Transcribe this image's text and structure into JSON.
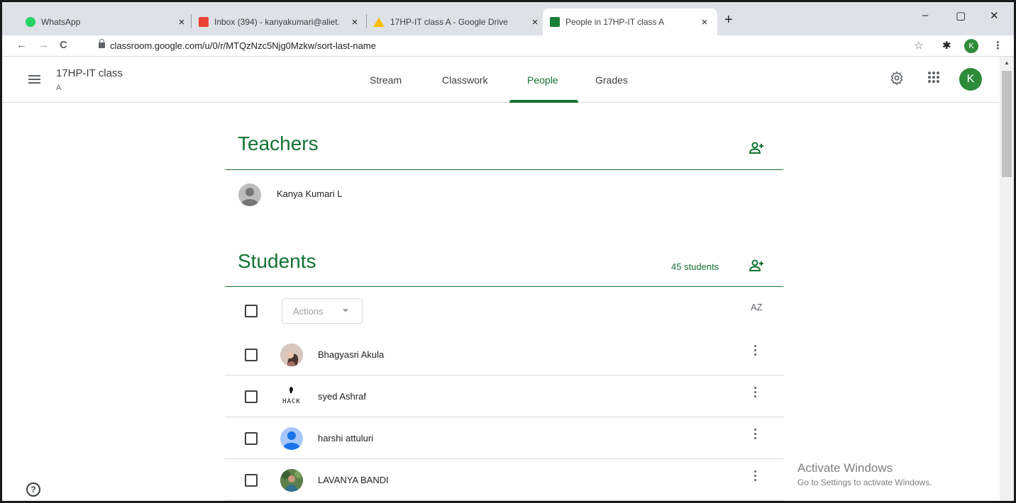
{
  "browser": {
    "tabs": [
      {
        "label": "WhatsApp",
        "favicon_color": "#25d366"
      },
      {
        "label": "Inbox (394) - kanyakumari@aliet.",
        "favicon_color": "#ea4335"
      },
      {
        "label": "17HP-IT class A - Google Drive",
        "favicon_color": "#fbbc04"
      },
      {
        "label": "People in 17HP-IT class A",
        "favicon_color": "#188038"
      }
    ],
    "tab_close": "×",
    "new_tab": "+",
    "window_controls": {
      "minimize": "–",
      "restore": "▢",
      "close": "✕"
    },
    "nav": {
      "back": "←",
      "forward": "→",
      "reload": "C"
    },
    "url": "classroom.google.com/u/0/r/MTQzNzc5Njg0Mzkw/sort-last-name",
    "profile_initial": "K",
    "icons": [
      "star-icon",
      "extensions-icon",
      "menu-dots-icon"
    ]
  },
  "classroom": {
    "class_name": "17HP-IT class",
    "class_section": "A",
    "tabs": [
      "Stream",
      "Classwork",
      "People",
      "Grades"
    ],
    "active_tab": "People",
    "account_initial": "K",
    "accent_color": "#137333"
  },
  "teachers": {
    "title": "Teachers",
    "list": [
      {
        "name": "Kanya Kumari L"
      }
    ]
  },
  "students": {
    "title": "Students",
    "count_label": "45 students",
    "actions_label": "Actions",
    "sort_label": "AZ",
    "list": [
      {
        "name": "Bhagyasri Akula",
        "avatar": "photo-avatar"
      },
      {
        "name": "syed Ashraf",
        "avatar": "hack-logo-avatar",
        "avatar_text": "HACK"
      },
      {
        "name": "harshi attuluri",
        "avatar": "default-avatar"
      },
      {
        "name": "LAVANYA BANDI",
        "avatar": "photo-avatar"
      }
    ]
  },
  "help_label": "?",
  "watermark": {
    "line1": "Activate Windows",
    "line2": "Go to Settings to activate Windows."
  }
}
